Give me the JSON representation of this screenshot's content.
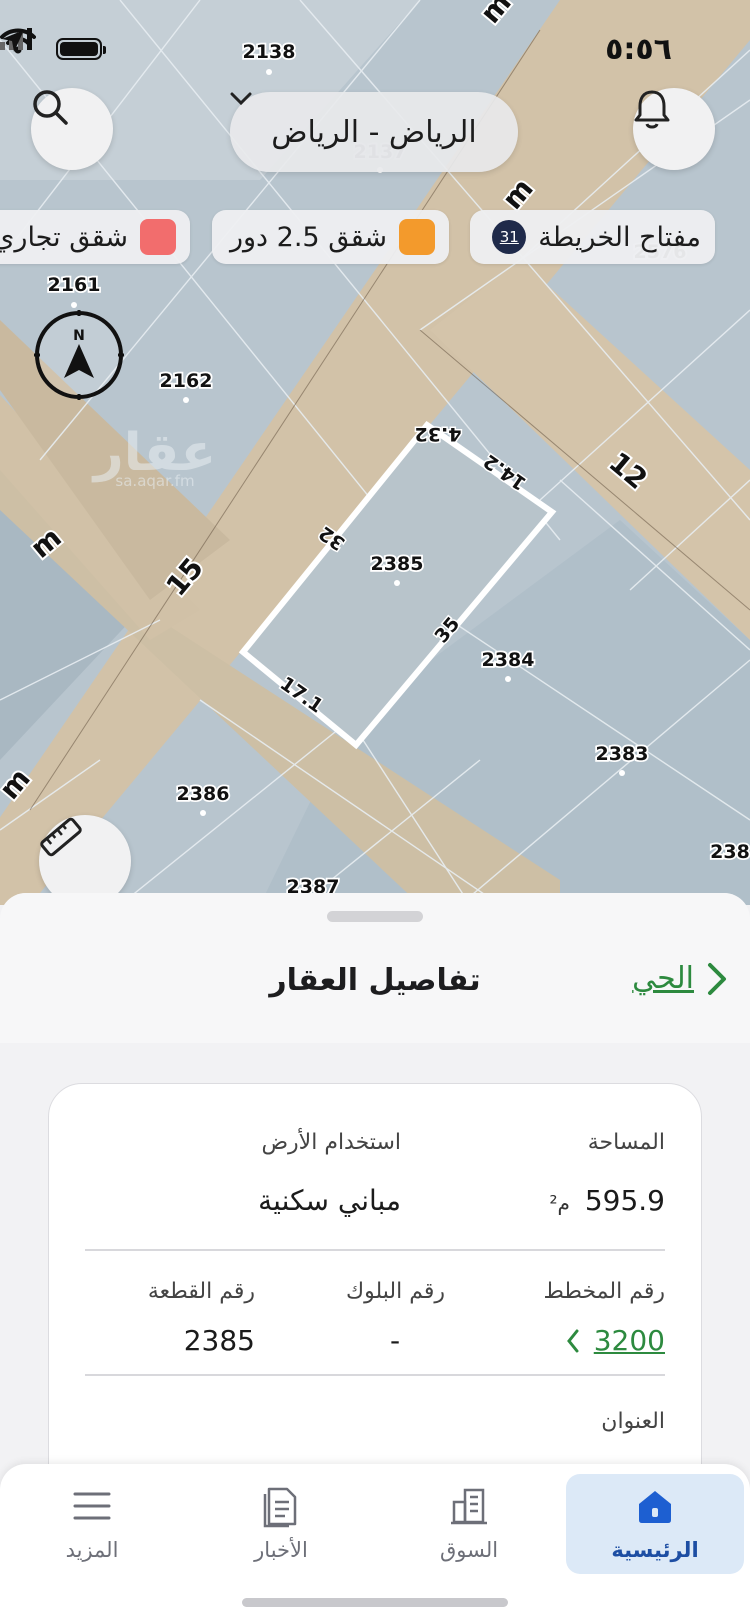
{
  "status_bar": {
    "time": "٥:٥٦"
  },
  "map": {
    "city_selector": "الرياض - الرياض",
    "legend_chips": [
      {
        "label": "مفتاح الخريطة",
        "badge": "31"
      },
      {
        "label": "شقق 2.5 دور",
        "color": "#f39a2c"
      },
      {
        "label": "شقق تجاري",
        "color": "#f26d6d"
      }
    ],
    "compass_letter": "N",
    "watermark": {
      "text": "عقار",
      "url": "sa.aqar.fm"
    },
    "parcel_labels": [
      "2138",
      "2137",
      "2576",
      "2161",
      "2162",
      "2385",
      "2384",
      "2383",
      "2386",
      "2387",
      "238"
    ],
    "street_labels": [
      "m",
      "m",
      "m",
      "m",
      "12",
      "15"
    ],
    "dimension_labels": [
      "4.32",
      "14.2",
      "32",
      "35",
      "17.1"
    ]
  },
  "sheet": {
    "title": "تفاصيل العقار",
    "district_link": "الحي",
    "fields": {
      "area_label": "المساحة",
      "area_value": "595.9",
      "area_unit": "م²",
      "land_use_label": "استخدام الأرض",
      "land_use_value": "مباني سكنية",
      "plan_label": "رقم المخطط",
      "plan_value": "3200",
      "block_label": "رقم البلوك",
      "block_value": "-",
      "parcel_label": "رقم القطعة",
      "parcel_value": "2385",
      "address_label": "العنوان"
    }
  },
  "tabs": [
    {
      "label": "الرئيسية",
      "icon": "home-icon",
      "active": true
    },
    {
      "label": "السوق",
      "icon": "building-icon"
    },
    {
      "label": "الأخبار",
      "icon": "news-icon"
    },
    {
      "label": "المزيد",
      "icon": "menu-icon"
    }
  ]
}
